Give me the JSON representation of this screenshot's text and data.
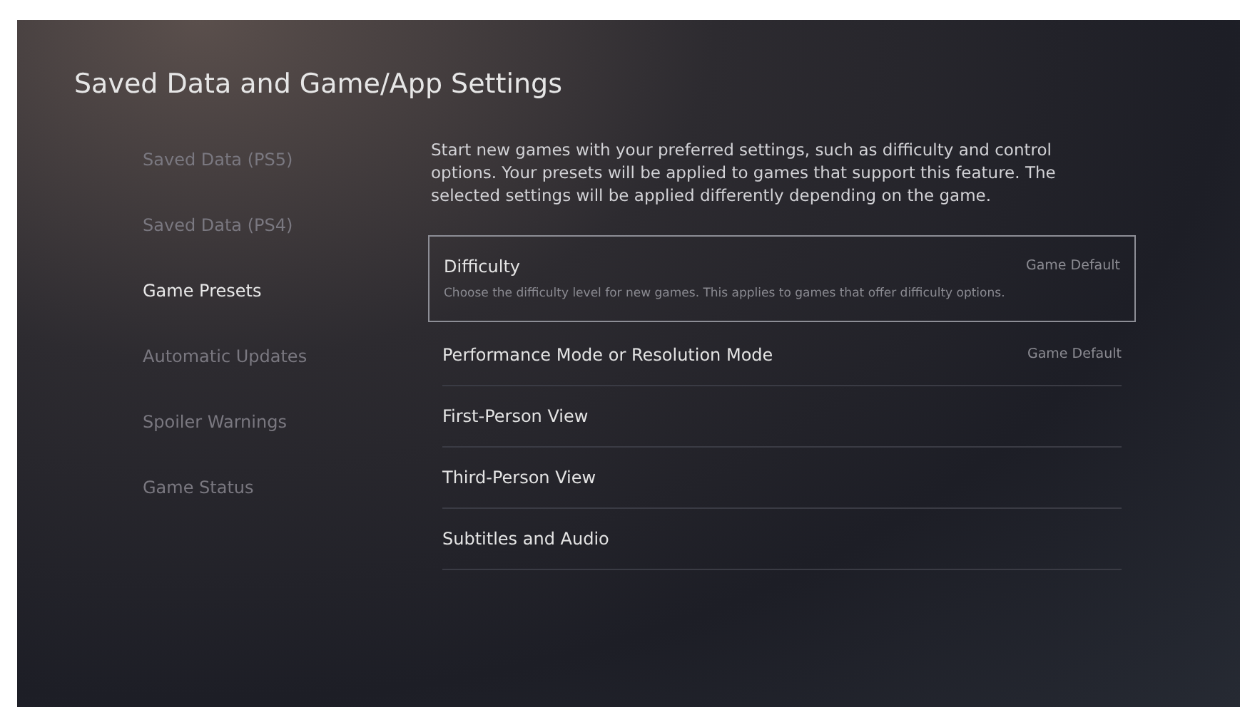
{
  "title": "Saved Data and Game/App Settings",
  "sidebar": {
    "items": [
      {
        "label": "Saved Data (PS5)",
        "selected": false
      },
      {
        "label": "Saved Data (PS4)",
        "selected": false
      },
      {
        "label": "Game Presets",
        "selected": true
      },
      {
        "label": "Automatic Updates",
        "selected": false
      },
      {
        "label": "Spoiler Warnings",
        "selected": false
      },
      {
        "label": "Game Status",
        "selected": false
      }
    ]
  },
  "description": "Start new games with your preferred settings, such as difficulty and control options. Your presets will be applied to games that support this feature. The selected settings will be applied differently depending on the game.",
  "settings": [
    {
      "label": "Difficulty",
      "value": "Game Default",
      "hint": "Choose the difficulty level for new games. This applies to games that offer difficulty options.",
      "selected": true
    },
    {
      "label": "Performance Mode or Resolution Mode",
      "value": "Game Default",
      "selected": false
    },
    {
      "label": "First-Person View",
      "selected": false
    },
    {
      "label": "Third-Person View",
      "selected": false
    },
    {
      "label": "Subtitles and Audio",
      "selected": false
    }
  ]
}
